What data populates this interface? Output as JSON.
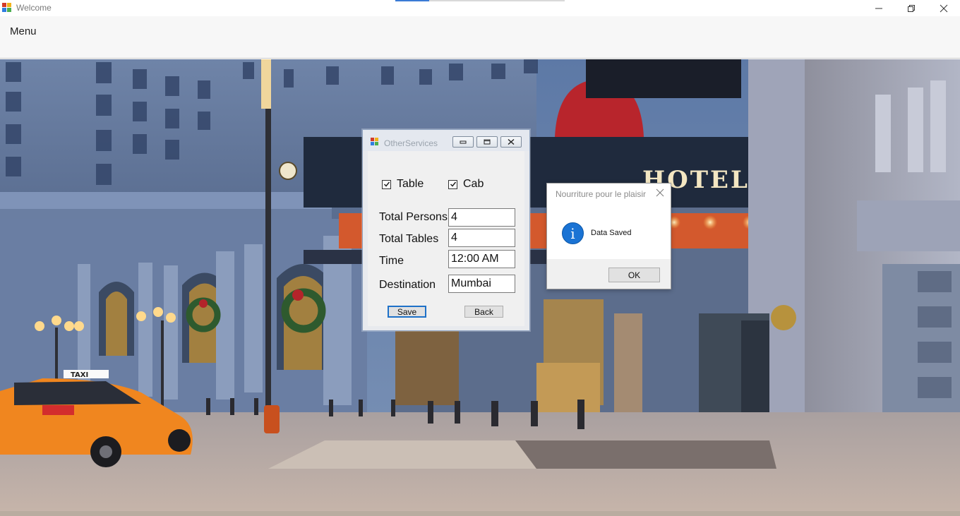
{
  "window": {
    "title": "Welcome"
  },
  "menu": {
    "items": [
      {
        "label": "Menu"
      }
    ]
  },
  "other_services": {
    "title": "OtherServices",
    "checkboxes": {
      "table": {
        "label": "Table",
        "checked": true
      },
      "cab": {
        "label": "Cab",
        "checked": true
      }
    },
    "fields": {
      "total_persons": {
        "label": "Total Persons",
        "value": "4"
      },
      "total_tables": {
        "label": "Total Tables",
        "value": "4"
      },
      "time": {
        "label": "Time",
        "value": "12:00 AM"
      },
      "destination": {
        "label": "Destination",
        "value": "Mumbai"
      }
    },
    "buttons": {
      "save": "Save",
      "back": "Back"
    }
  },
  "message_box": {
    "title": "Nourriture pour le plaisir",
    "icon": "info-icon",
    "icon_glyph": "i",
    "text": "Data Saved",
    "ok": "OK"
  },
  "background": {
    "sign_text": "HOTEL",
    "taxi_sign": "TAXI"
  },
  "colors": {
    "accent": "#1e71c8",
    "info": "#1a73d4"
  }
}
